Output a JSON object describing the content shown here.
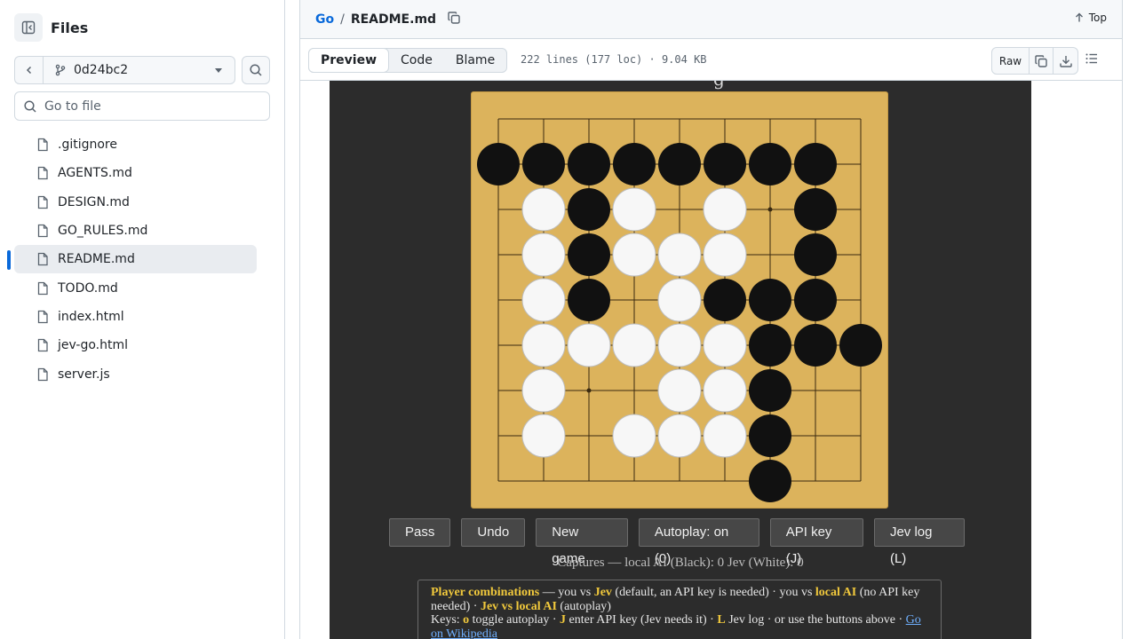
{
  "sidebar": {
    "title": "Files",
    "branch": "0d24bc2",
    "goto_placeholder": "Go to file",
    "files": [
      {
        "name": ".gitignore"
      },
      {
        "name": "AGENTS.md"
      },
      {
        "name": "DESIGN.md"
      },
      {
        "name": "GO_RULES.md"
      },
      {
        "name": "README.md",
        "active": true
      },
      {
        "name": "TODO.md"
      },
      {
        "name": "index.html"
      },
      {
        "name": "jev-go.html"
      },
      {
        "name": "server.js"
      }
    ]
  },
  "header": {
    "repo": "Go",
    "separator": "/",
    "file": "README.md",
    "top_label": "Top"
  },
  "toolbar": {
    "tabs": [
      "Preview",
      "Code",
      "Blame"
    ],
    "selected_tab": "Preview",
    "meta": "222 lines (177 loc) · 9.04 KB",
    "raw_label": "Raw"
  },
  "game": {
    "board_size": 9,
    "star_points": [
      [
        2,
        2
      ],
      [
        6,
        2
      ],
      [
        2,
        6
      ],
      [
        6,
        6
      ],
      [
        4,
        4
      ]
    ],
    "stones": {
      "black": [
        [
          0,
          1
        ],
        [
          1,
          1
        ],
        [
          2,
          1
        ],
        [
          3,
          1
        ],
        [
          4,
          1
        ],
        [
          5,
          1
        ],
        [
          6,
          1
        ],
        [
          7,
          1
        ],
        [
          2,
          2
        ],
        [
          7,
          2
        ],
        [
          2,
          3
        ],
        [
          7,
          3
        ],
        [
          2,
          4
        ],
        [
          5,
          4
        ],
        [
          6,
          4
        ],
        [
          7,
          4
        ],
        [
          6,
          5
        ],
        [
          7,
          5
        ],
        [
          8,
          5
        ],
        [
          6,
          6
        ],
        [
          6,
          7
        ],
        [
          6,
          8
        ]
      ],
      "white": [
        [
          1,
          2
        ],
        [
          3,
          2
        ],
        [
          5,
          2
        ],
        [
          1,
          3
        ],
        [
          3,
          3
        ],
        [
          4,
          3
        ],
        [
          5,
          3
        ],
        [
          1,
          4
        ],
        [
          4,
          4
        ],
        [
          1,
          5
        ],
        [
          2,
          5
        ],
        [
          3,
          5
        ],
        [
          4,
          5
        ],
        [
          5,
          5
        ],
        [
          1,
          6
        ],
        [
          4,
          6
        ],
        [
          5,
          6
        ],
        [
          1,
          7
        ],
        [
          3,
          7
        ],
        [
          4,
          7
        ],
        [
          5,
          7
        ]
      ]
    },
    "buttons": [
      "Pass",
      "Undo",
      "New game",
      "Autoplay: on (0)",
      "API key (J)",
      "Jev log (L)"
    ],
    "captures": "Captures — local AI (Black): 0 Jev (White): 0",
    "info": {
      "line1_label": "Player combinations",
      "line1_a": " — you vs ",
      "jev1": "Jev",
      "line1_b": " (default, an API key is needed) · you vs ",
      "local_ai": "local AI",
      "line1_c": " (no API key needed) · ",
      "jev_vs": "Jev vs local AI",
      "line1_d": " (autoplay)",
      "keys_a": "Keys: ",
      "key_o": "o",
      "keys_b": " toggle autoplay · ",
      "key_j": "J",
      "keys_c": " enter API key (Jev needs it) · ",
      "key_l": "L",
      "keys_d": " Jev log · or use the buttons above · ",
      "link": "Go on Wikipedia"
    },
    "colors": {
      "board": "#dcb35c",
      "black_stone": "#111111",
      "white_stone": "#f7f7f7",
      "background": "#2c2c2c"
    }
  }
}
